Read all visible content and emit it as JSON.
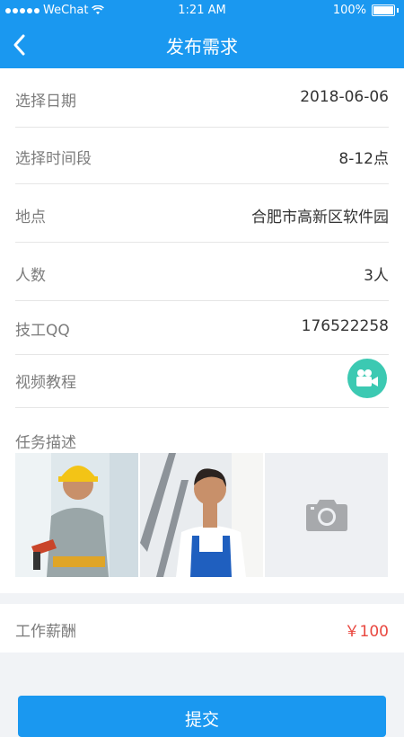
{
  "status_bar": {
    "carrier": "WeChat",
    "time": "1:21 AM",
    "battery": "100%"
  },
  "nav": {
    "title": "发布需求"
  },
  "form": {
    "date_label": "选择日期",
    "date_value": "2018-06-06",
    "time_label": "选择时间段",
    "time_value": "8-12点",
    "location_label": "地点",
    "location_value": "合肥市高新区软件园",
    "people_label": "人数",
    "people_value": "3人",
    "qq_label": "技工QQ",
    "qq_value": "176522258",
    "video_label": "视频教程",
    "task_label": "任务描述"
  },
  "payment": {
    "label": "工作薪酬",
    "value": "￥100"
  },
  "submit": {
    "label": "提交"
  },
  "colors": {
    "primary": "#1a98f0",
    "video_icon_bg": "#3cc9b2",
    "price": "#e9473f"
  }
}
